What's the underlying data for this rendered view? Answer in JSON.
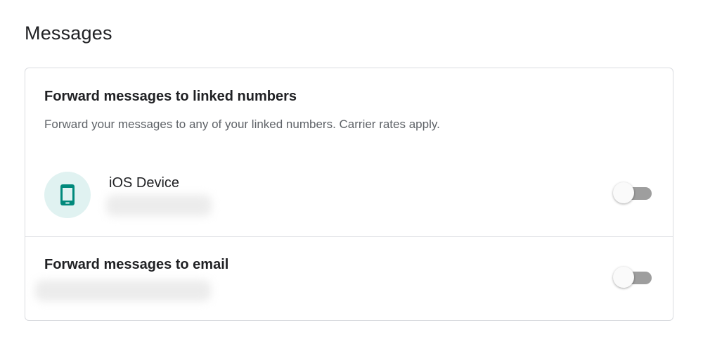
{
  "section": {
    "title": "Messages"
  },
  "linked_numbers": {
    "heading": "Forward messages to linked numbers",
    "description": "Forward your messages to any of your linked numbers. Carrier rates apply.",
    "devices": [
      {
        "name": "iOS Device",
        "icon": "smartphone-icon",
        "enabled": false
      }
    ]
  },
  "email_forwarding": {
    "heading": "Forward messages to email",
    "enabled": false
  },
  "colors": {
    "avatar_bg": "#e0f2f1",
    "phone_icon": "#00897b",
    "toggle_track_off": "#9e9e9e",
    "toggle_thumb_off": "#fafafa",
    "divider": "#dadce0"
  }
}
